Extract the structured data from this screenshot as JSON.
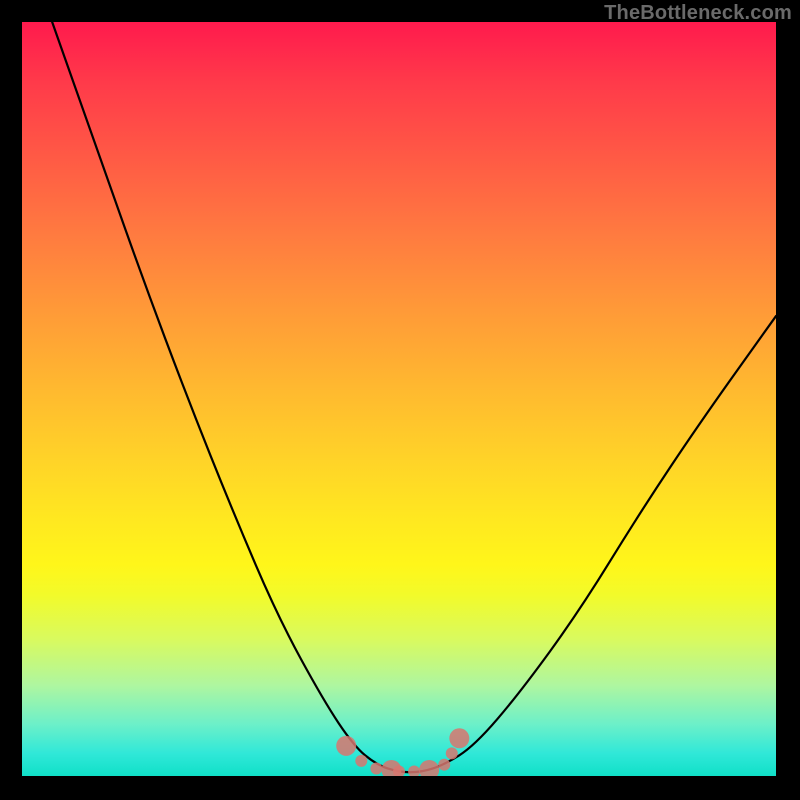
{
  "watermark": "TheBottleneck.com",
  "chart_data": {
    "type": "line",
    "title": "",
    "xlabel": "",
    "ylabel": "",
    "xlim": [
      0,
      100
    ],
    "ylim": [
      0,
      100
    ],
    "legend": false,
    "grid": false,
    "background_gradient": {
      "top": "#ff1a4d",
      "mid": "#ffe820",
      "bottom": "#10e0c8"
    },
    "series": [
      {
        "name": "curve",
        "color": "#000000",
        "x": [
          4,
          10,
          16,
          22,
          28,
          34,
          40,
          44,
          47,
          50,
          53,
          56,
          60,
          66,
          74,
          82,
          90,
          100
        ],
        "y": [
          100,
          83,
          66,
          50,
          35,
          21,
          10,
          4,
          1.5,
          0.5,
          0.5,
          1.5,
          4,
          11,
          22,
          35,
          47,
          61
        ]
      },
      {
        "name": "bottom-markers",
        "color": "#d8766f",
        "type": "scatter",
        "x": [
          43,
          45,
          47,
          49,
          50,
          52,
          54,
          56,
          57,
          58
        ],
        "y": [
          4,
          2,
          1,
          0.8,
          0.6,
          0.6,
          0.8,
          1.5,
          3,
          5
        ]
      }
    ]
  }
}
